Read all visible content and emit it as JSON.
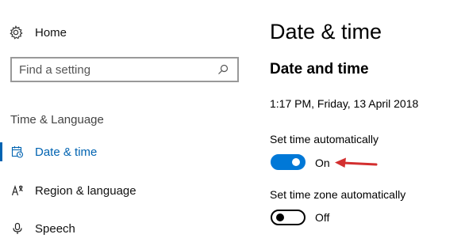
{
  "sidebar": {
    "home_label": "Home",
    "search": {
      "placeholder": "Find a setting"
    },
    "section_label": "Time & Language",
    "items": [
      {
        "label": "Date & time",
        "icon": "calendar-clock-icon",
        "active": true
      },
      {
        "label": "Region & language",
        "icon": "language-icon",
        "active": false
      },
      {
        "label": "Speech",
        "icon": "microphone-icon",
        "active": false
      }
    ]
  },
  "main": {
    "title": "Date & time",
    "subtitle": "Date and time",
    "current_time": "1:17 PM, Friday, 13 April 2018",
    "settings": [
      {
        "label": "Set time automatically",
        "state": "On",
        "on": true
      },
      {
        "label": "Set time zone automatically",
        "state": "Off",
        "on": false
      }
    ]
  },
  "colors": {
    "accent": "#0078d7",
    "nav_active": "#0063b1",
    "annotation_arrow": "#d32f2f"
  }
}
